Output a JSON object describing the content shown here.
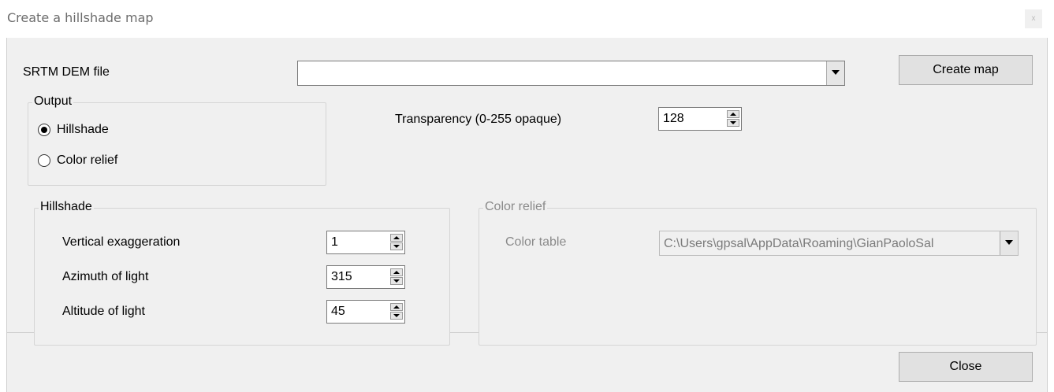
{
  "window": {
    "title": "Create a hillshade map",
    "close_glyph": "x"
  },
  "dem": {
    "label": "SRTM DEM file",
    "value": ""
  },
  "buttons": {
    "create_map": "Create map",
    "close": "Close"
  },
  "output": {
    "title": "Output",
    "options": [
      {
        "label": "Hillshade",
        "selected": true
      },
      {
        "label": "Color relief",
        "selected": false
      }
    ]
  },
  "transparency": {
    "label": "Transparency (0-255 opaque)",
    "value": "128"
  },
  "hillshade": {
    "title": "Hillshade",
    "vertical_exaggeration": {
      "label": "Vertical exaggeration",
      "value": "1"
    },
    "azimuth": {
      "label": "Azimuth of light",
      "value": "315"
    },
    "altitude": {
      "label": "Altitude of light",
      "value": "45"
    }
  },
  "color_relief": {
    "title": "Color relief",
    "enabled": false,
    "color_table": {
      "label": "Color table",
      "value": "C:\\Users\\gpsal\\AppData\\Roaming\\GianPaoloSal"
    }
  }
}
